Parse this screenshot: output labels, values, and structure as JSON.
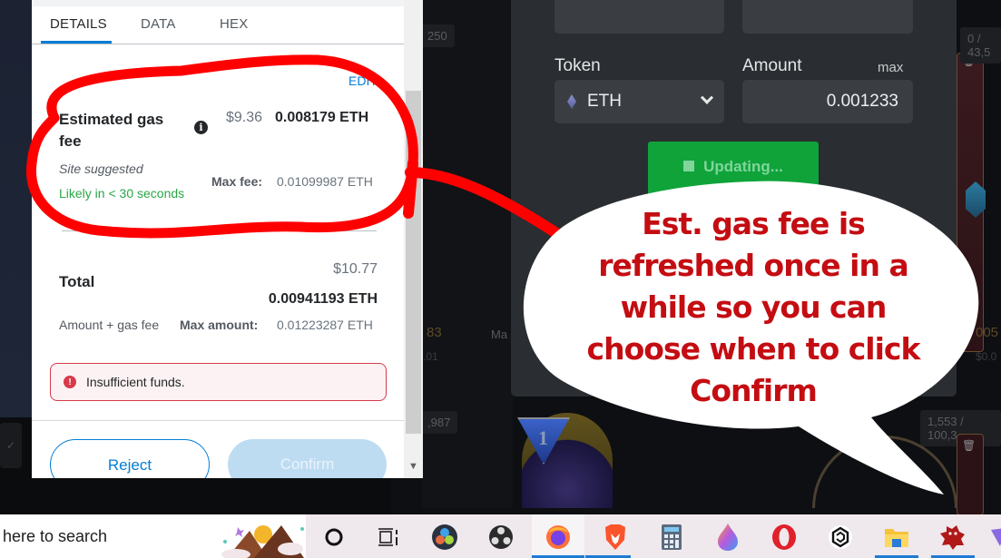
{
  "background": {
    "badges": [
      "250",
      "0 / 43,5",
      ",987",
      "1,553 / 100,3"
    ],
    "faint_values": [
      "83",
      ".01",
      "005",
      "$0.0"
    ],
    "partial_label": "Ma",
    "emblem_number": "1"
  },
  "app_panel": {
    "token_label": "Token",
    "amount_label": "Amount",
    "max_link": "max",
    "token_value": "ETH",
    "amount_value": "0.001233",
    "updating_button": "Updating..."
  },
  "metamask": {
    "tabs": [
      {
        "label": "DETAILS",
        "active": true
      },
      {
        "label": "DATA",
        "active": false
      },
      {
        "label": "HEX",
        "active": false
      }
    ],
    "edit_link": "EDIT",
    "gas": {
      "title": "Estimated gas fee",
      "usd": "$9.36",
      "eth": "0.008179 ETH",
      "source": "Site suggested",
      "likely": "Likely in < 30 seconds",
      "max_fee_label": "Max fee:",
      "max_fee_value": "0.01099987 ETH"
    },
    "total": {
      "label": "Total",
      "usd": "$10.77",
      "eth": "0.00941193 ETH",
      "sublabel": "Amount + gas fee",
      "max_amount_label": "Max amount:",
      "max_amount_value": "0.01223287 ETH"
    },
    "error": "Insufficient funds.",
    "reject_label": "Reject",
    "confirm_label": "Confirm",
    "accent_color": "#037dd6",
    "error_color": "#d73a49"
  },
  "annotation": {
    "callout_lines": [
      "Est. gas fee is",
      "refreshed once in a",
      "while so you can",
      "choose when to click",
      "Confirm"
    ],
    "ink_color": "#ff0000",
    "text_color": "#c40d12"
  },
  "taskbar": {
    "search_text": "here to search",
    "apps": [
      {
        "name": "cortana-icon",
        "active": false
      },
      {
        "name": "task-view-icon",
        "active": false
      },
      {
        "name": "davinci-resolve-icon",
        "active": false
      },
      {
        "name": "obs-studio-icon",
        "active": false
      },
      {
        "name": "firefox-icon",
        "active": true
      },
      {
        "name": "brave-icon",
        "active": true
      },
      {
        "name": "calculator-icon",
        "active": false
      },
      {
        "name": "firefox-nightly-icon",
        "active": false
      },
      {
        "name": "opera-icon",
        "active": false
      },
      {
        "name": "crypto-app-icon",
        "active": false
      },
      {
        "name": "file-explorer-icon",
        "active": true
      },
      {
        "name": "red-puzzle-app-icon",
        "active": true
      }
    ]
  }
}
